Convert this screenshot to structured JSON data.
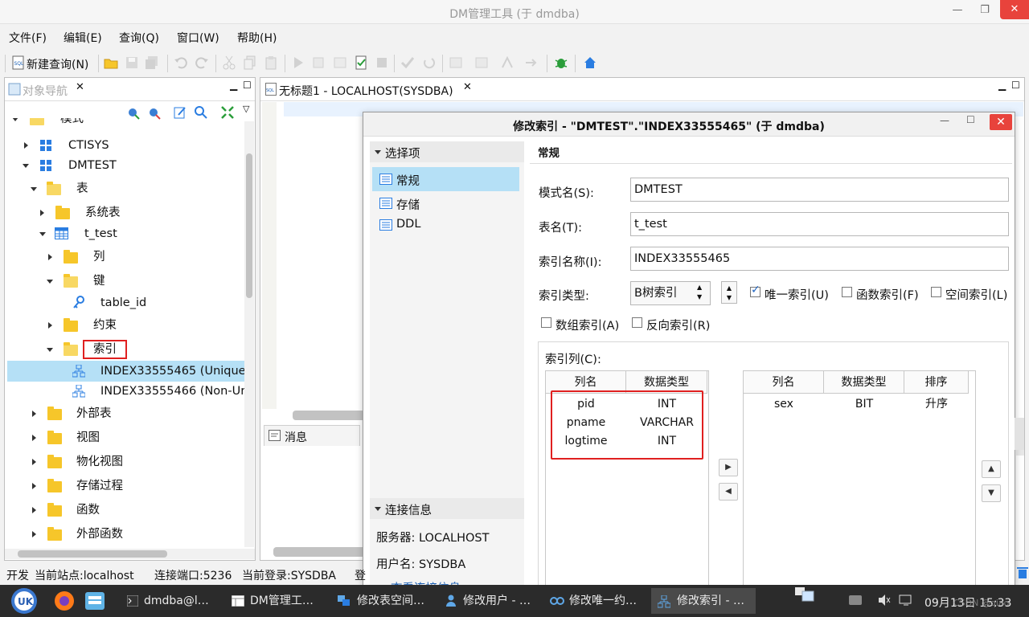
{
  "window": {
    "title": "DM管理工具 (于 dmdba)"
  },
  "menu": [
    "文件(F)",
    "编辑(E)",
    "查询(Q)",
    "窗口(W)",
    "帮助(H)"
  ],
  "toolbar": {
    "new_query": "新建查询(N)"
  },
  "navigator": {
    "tab": "对象导航",
    "tree": {
      "schema_root": "模式",
      "ctisys": "CTISYS",
      "dmtest": "DMTEST",
      "tables": "表",
      "system_tables": "系统表",
      "t_test": "t_test",
      "columns": "列",
      "keys": "键",
      "table_id": "table_id",
      "constraints": "约束",
      "indexes": "索引",
      "index1": "INDEX33555465 (Unique",
      "index2": "INDEX33555466 (Non-Ur",
      "external_tables": "外部表",
      "views": "视图",
      "mviews": "物化视图",
      "procedures": "存储过程",
      "functions": "函数",
      "ext_functions": "外部函数"
    }
  },
  "editor": {
    "tab": "无标题1 - LOCALHOST(SYSDBA)",
    "messages_tab": "消息"
  },
  "dialog": {
    "title": "修改索引 - \"DMTEST\".\"INDEX33555465\" (于 dmdba)",
    "options_header": "选择项",
    "options": [
      "常规",
      "存储",
      "DDL"
    ],
    "conn_header": "连接信息",
    "server": "服务器: LOCALHOST",
    "user": "用户名: SYSDBA",
    "view_conn": "查看连接信息",
    "section": "常规",
    "schema_label": "模式名(S):",
    "schema_value": "DMTEST",
    "table_label": "表名(T):",
    "table_value": "t_test",
    "index_name_label": "索引名称(I):",
    "index_name_value": "INDEX33555465",
    "index_type_label": "索引类型:",
    "index_type_value": "B树索引",
    "unique": "唯一索引(U)",
    "function_index": "函数索引(F)",
    "spatial_index": "空间索引(L)",
    "array_index": "数组索引(A)",
    "reverse_index": "反向索引(R)",
    "index_cols_label": "索引列(C):",
    "left_headers": [
      "列名",
      "数据类型"
    ],
    "left_rows": [
      {
        "name": "pid",
        "type": "INT"
      },
      {
        "name": "pname",
        "type": "VARCHAR"
      },
      {
        "name": "logtime",
        "type": "INT"
      }
    ],
    "right_headers": [
      "列名",
      "数据类型",
      "排序"
    ],
    "right_rows": [
      {
        "name": "sex",
        "type": "BIT",
        "order": "升序"
      }
    ]
  },
  "status": {
    "mode": "开发",
    "site": "当前站点:localhost",
    "port": "连接端口:5236",
    "login": "当前登录:SYSDBA",
    "extra": "登"
  },
  "taskbar": {
    "items": [
      "dmdba@l…",
      "DM管理工…",
      "修改表空间…",
      "修改用户 - …",
      "修改唯一约…",
      "修改索引 - …"
    ],
    "clock": "09月13日 15:33",
    "watermark": "CSDN @qiao"
  },
  "colors": {
    "selection": "#b5e0f6",
    "highlight_border": "#e02020",
    "close_red": "#e8433c"
  }
}
